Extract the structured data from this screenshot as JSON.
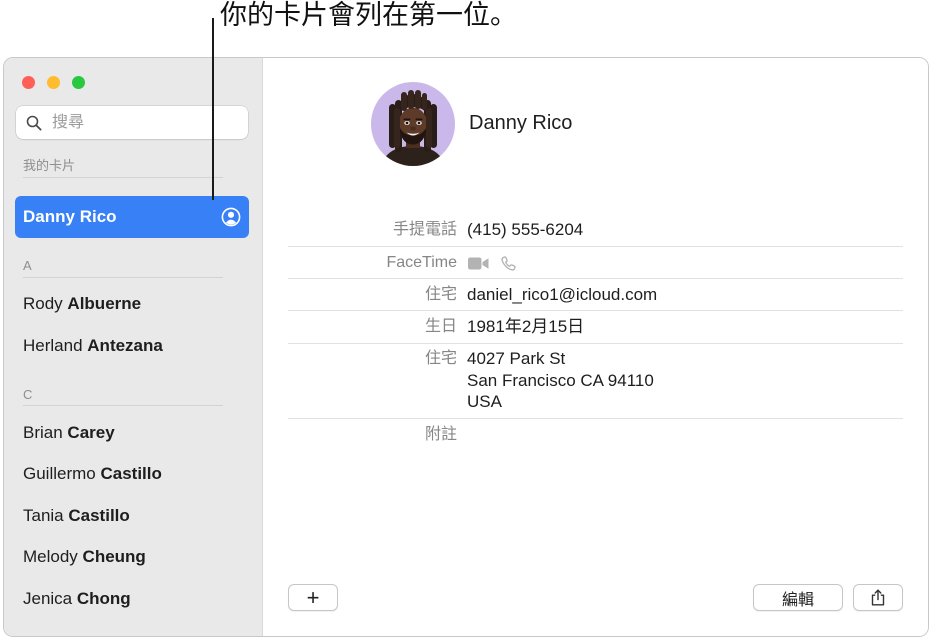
{
  "annotation": {
    "text": "你的卡片會列在第一位。"
  },
  "colors": {
    "accent": "#3880f6",
    "traffic_red": "#ff5f57",
    "traffic_yellow": "#febc2e",
    "traffic_green": "#28c840",
    "sidebar_bg": "#e9e9e9"
  },
  "sidebar": {
    "search": {
      "icon": "search-icon",
      "placeholder": "搜尋"
    },
    "my_card": {
      "header": "我的卡片",
      "contact": {
        "first": "Danny",
        "last": "Rico",
        "icon": "person-circle-icon",
        "selected": true
      }
    },
    "sections": [
      {
        "letter": "A",
        "contacts": [
          {
            "first": "Rody",
            "last": "Albuerne"
          },
          {
            "first": "Herland",
            "last": "Antezana"
          }
        ]
      },
      {
        "letter": "C",
        "contacts": [
          {
            "first": "Brian",
            "last": "Carey"
          },
          {
            "first": "Guillermo",
            "last": "Castillo"
          },
          {
            "first": "Tania",
            "last": "Castillo"
          },
          {
            "first": "Melody",
            "last": "Cheung"
          },
          {
            "first": "Jenica",
            "last": "Chong"
          }
        ]
      }
    ]
  },
  "card": {
    "name": "Danny Rico",
    "fields": {
      "mobile": {
        "label": "手提電話",
        "value": "(415) 555-6204"
      },
      "facetime": {
        "label": "FaceTime",
        "icons": [
          "video-icon",
          "phone-icon"
        ]
      },
      "home_email": {
        "label": "住宅",
        "value": "daniel_rico1@icloud.com"
      },
      "birthday": {
        "label": "生日",
        "value": "1981年2月15日"
      },
      "home_address": {
        "label": "住宅",
        "lines": [
          "4027 Park St",
          "San Francisco CA 94110",
          "USA"
        ]
      },
      "note": {
        "label": "附註"
      }
    }
  },
  "toolbar": {
    "add_label": "+",
    "edit_label": "編輯",
    "share_icon": "share-icon"
  }
}
